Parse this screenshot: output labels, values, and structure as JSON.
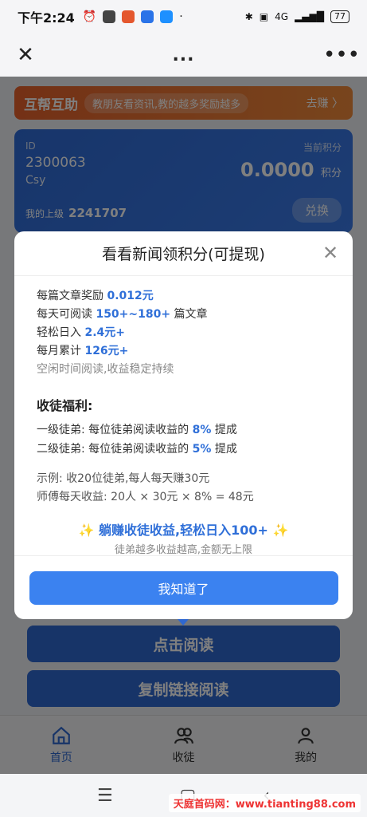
{
  "status_bar": {
    "time": "下午2:24",
    "network": "4G",
    "battery": "77"
  },
  "top_nav": {
    "title": "..."
  },
  "banner": {
    "title": "互帮互助",
    "tagline": "教朋友看资讯,教的越多奖励越多",
    "action": "去赚 〉"
  },
  "account": {
    "id_label": "ID",
    "id": "2300063",
    "name": "Csy",
    "points_label": "当前积分",
    "points": "0.0000",
    "points_unit": "积分",
    "superior_label": "我的上级",
    "superior_id": "2241707",
    "exchange_label": "兑换"
  },
  "buttons": {
    "click_read": "点击阅读",
    "copy_link_read": "复制链接阅读"
  },
  "modal": {
    "title": "看看新闻领积分(可提现)",
    "lines": [
      {
        "prefix": "每篇文章奖励 ",
        "value": "0.012元",
        "suffix": ""
      },
      {
        "prefix": "每天可阅读 ",
        "value": "150+~180+",
        "suffix": " 篇文章"
      },
      {
        "prefix": "轻松日入 ",
        "value": "2.4元+",
        "suffix": ""
      },
      {
        "prefix": "每月累计 ",
        "value": "126元+",
        "suffix": ""
      }
    ],
    "note": "空闲时间阅读,收益稳定持续",
    "section_title": "收徒福利:",
    "levels": [
      {
        "prefix": "一级徒弟: 每位徒弟阅读收益的 ",
        "value": "8%",
        "suffix": " 提成"
      },
      {
        "prefix": "二级徒弟: 每位徒弟阅读收益的 ",
        "value": "5%",
        "suffix": " 提成"
      }
    ],
    "example_1": "示例: 收20位徒弟,每人每天赚30元",
    "example_2": "师傅每天收益: 20人 × 30元 × 8% = 48元",
    "promo_main": "躺赚收徒收益,轻松日入100+",
    "promo_sub": "徒弟越多收益越高,金额无上限",
    "ok_label": "我知道了"
  },
  "tabs": [
    {
      "label": "首页",
      "active": true
    },
    {
      "label": "收徒",
      "active": false
    },
    {
      "label": "我的",
      "active": false
    }
  ],
  "watermark": "天庭首码网：www.tianting88.com",
  "colors": {
    "primary": "#2f68d0",
    "accent_blue": "#2f6fd8",
    "banner_orange": "#e8622c",
    "ok_button": "#3b82f0"
  }
}
